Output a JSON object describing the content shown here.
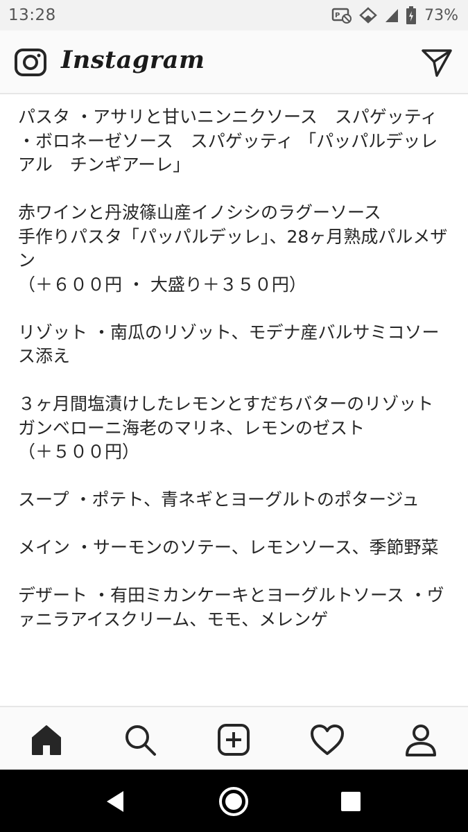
{
  "status_bar": {
    "time": "13:28",
    "battery_percent": "73%",
    "icons": [
      "no-sync-icon",
      "wifi-icon",
      "cell-signal-icon",
      "battery-charging-icon"
    ]
  },
  "header": {
    "logo_text": "Instagram",
    "left_icon": "camera-icon",
    "right_icon": "direct-message-icon"
  },
  "caption": {
    "paragraphs": [
      "パスタ ・アサリと甘いニンニクソース　スパゲッティ ・ボロネーゼソース　スパゲッティ 「パッパルデッレ　アル　チンギアーレ」",
      "",
      "赤ワインと丹波篠山産イノシシのラグーソース",
      "手作りパスタ「パッパルデッレ」、28ヶ月熟成パルメザン",
      "（＋６００円 ・ 大盛り＋３５０円）",
      "",
      "リゾット ・南瓜のリゾット、モデナ産バルサミコソース添え",
      "",
      "３ヶ月間塩漬けしたレモンとすだちバターのリゾット",
      "ガンベローニ海老のマリネ、レモンのゼスト",
      "（＋５００円）",
      "",
      "スープ ・ポテト、青ネギとヨーグルトのポタージュ",
      "",
      "メイン ・サーモンのソテー、レモンソース、季節野菜",
      "",
      "デザート ・有田ミカンケーキとヨーグルトソース ・ヴァニラアイスクリーム、モモ、メレンゲ"
    ]
  },
  "bottom_nav": {
    "items": [
      "home-icon",
      "search-icon",
      "add-post-icon",
      "activity-heart-icon",
      "profile-icon"
    ],
    "active": "home-icon"
  },
  "android_nav": {
    "items": [
      "back-icon",
      "home-circle-icon",
      "recents-icon"
    ]
  }
}
